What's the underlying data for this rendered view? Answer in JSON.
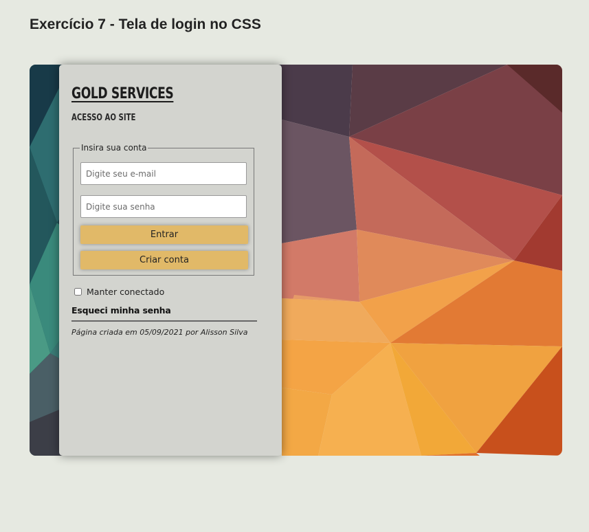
{
  "page": {
    "title": "Exercício 7 - Tela de login no CSS"
  },
  "login": {
    "brand": "Gold Services",
    "subtitle": "Acesso ao site",
    "form": {
      "legend": "Insira sua conta",
      "email_placeholder": "Digite seu e-mail",
      "password_placeholder": "Digite sua senha",
      "submit_label": "Entrar",
      "create_label": "Criar conta"
    },
    "remember_label": "Manter conectado",
    "forgot_label": "Esqueci minha senha",
    "footer": "Página criada em 05/09/2021 por Alisson Silva"
  },
  "colors": {
    "background": "#e6e9e1",
    "panel": "#d3d4cf",
    "button": "#e1b968"
  }
}
